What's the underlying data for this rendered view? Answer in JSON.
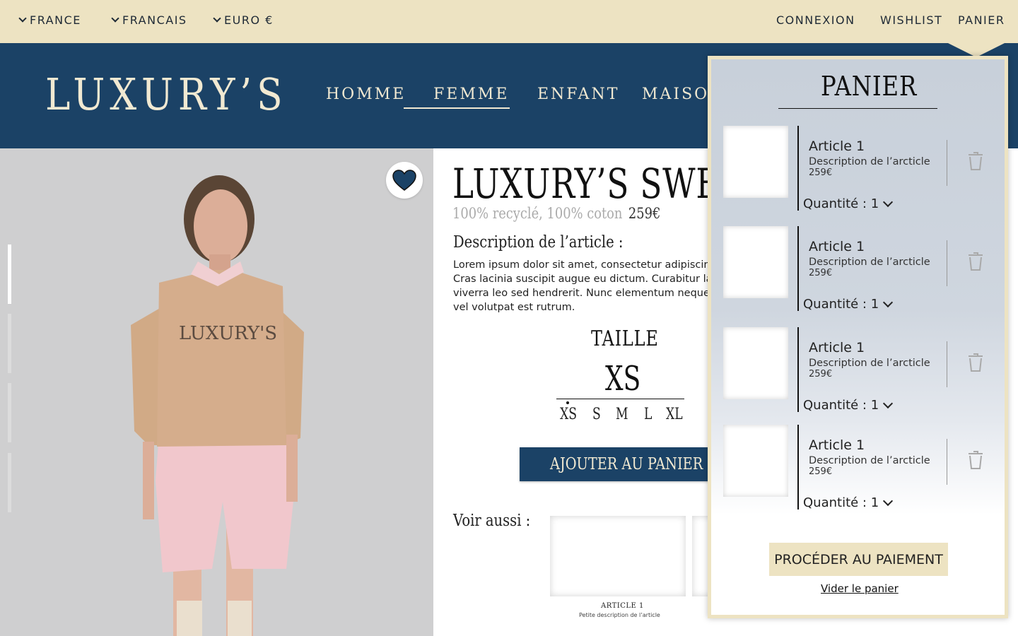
{
  "topbar": {
    "country": "FRANCE",
    "language": "FRANCAIS",
    "currency": "EURO €",
    "login": "CONNEXION",
    "wishlist": "WISHLIST",
    "cart": "PANIER",
    "background": "#ede3c2"
  },
  "header": {
    "logo": "LUXURY’S",
    "nav": [
      "HOMME",
      "FEMME",
      "ENFANT",
      "MAISON"
    ],
    "active_nav": "FEMME",
    "background": "#1b4266"
  },
  "product": {
    "title": "LUXURY’S SWEAT",
    "subtitle": "100% recyclé, 100% coton",
    "price": "259€",
    "description_label": "Description de l’article :",
    "description": "Lorem ipsum dolor sit amet, consectetur adipiscing\nCras lacinia suscipit augue eu dictum. Curabitur la\nviverra leo sed hendrerit. Nunc elementum neque\nvel volutpat est rutrum.",
    "printed_brand": "LUXURY'S",
    "size_label": "TAILLE",
    "selected_size": "XS",
    "sizes": [
      "XS",
      "S",
      "M",
      "L",
      "XL"
    ],
    "add_to_cart": "AJOUTER AU PANIER",
    "favorite_icon": "heart-icon",
    "see_also_label": "Voir aussi :",
    "related": [
      {
        "title": "ARTICLE 1",
        "description": "Petite description de l’article"
      }
    ]
  },
  "cart": {
    "title": "PANIER",
    "items": [
      {
        "name": "Article 1",
        "description": "Description de l’arcticle",
        "price": "259€",
        "quantity": "Quantité : 1"
      },
      {
        "name": "Article 1",
        "description": "Description de l’arcticle",
        "price": "259€",
        "quantity": "Quantité : 1"
      },
      {
        "name": "Article 1",
        "description": "Description de l’arcticle",
        "price": "259€",
        "quantity": "Quantité : 1"
      },
      {
        "name": "Article 1",
        "description": "Description de l’arcticle",
        "price": "259€",
        "quantity": "Quantité : 1"
      }
    ],
    "pay_button": "PROCÉDER AU PAIEMENT",
    "clear_link": "Vider le panier",
    "trash_icon": "trash-icon"
  }
}
